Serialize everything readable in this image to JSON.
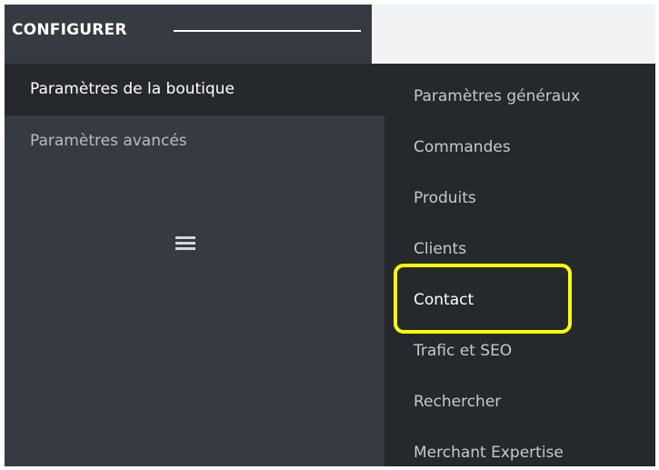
{
  "header": {
    "title": "CONFIGURER"
  },
  "left_menu": {
    "items": [
      {
        "label": "Paramètres de la boutique",
        "active": true
      },
      {
        "label": "Paramètres avancés",
        "active": false
      }
    ],
    "menu_icon": "hamburger-icon"
  },
  "submenu": {
    "items": [
      {
        "label": "Paramètres généraux"
      },
      {
        "label": "Commandes"
      },
      {
        "label": "Produits"
      },
      {
        "label": "Clients"
      },
      {
        "label": "Contact",
        "highlighted": true
      },
      {
        "label": "Trafic et SEO"
      },
      {
        "label": "Rechercher"
      },
      {
        "label": "Merchant Expertise"
      }
    ]
  },
  "colors": {
    "sidebar_bg": "#363a41",
    "active_bg": "#25282d",
    "highlight_border": "#ffff00"
  }
}
